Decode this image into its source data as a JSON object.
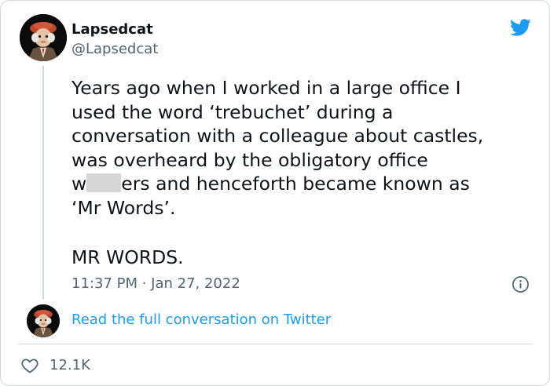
{
  "author": {
    "name": "Lapsedcat",
    "handle": "@Lapsedcat"
  },
  "tweet": {
    "lines": [
      "Years ago when I worked in a large office I",
      "used the word ‘trebuchet’ during a",
      "conversation with a colleague about castles,",
      "was overheard by the obligatory office",
      {
        "before": "w",
        "after": "ers and henceforth became known as"
      },
      "‘Mr Words’."
    ],
    "shout": "MR WORDS.",
    "timestamp": "11:37 PM · Jan 27, 2022"
  },
  "thread": {
    "read_more": "Read the full conversation on Twitter"
  },
  "actions": {
    "likes": "12.1K"
  },
  "icons": {
    "brand": "twitter-bird-icon",
    "info": "info-icon",
    "like": "heart-icon"
  },
  "colors": {
    "brand_blue": "#1d9bf0",
    "text": "#0f1419",
    "secondary": "#536471",
    "border": "#cfd9de",
    "redaction": "#d6d6d6"
  }
}
